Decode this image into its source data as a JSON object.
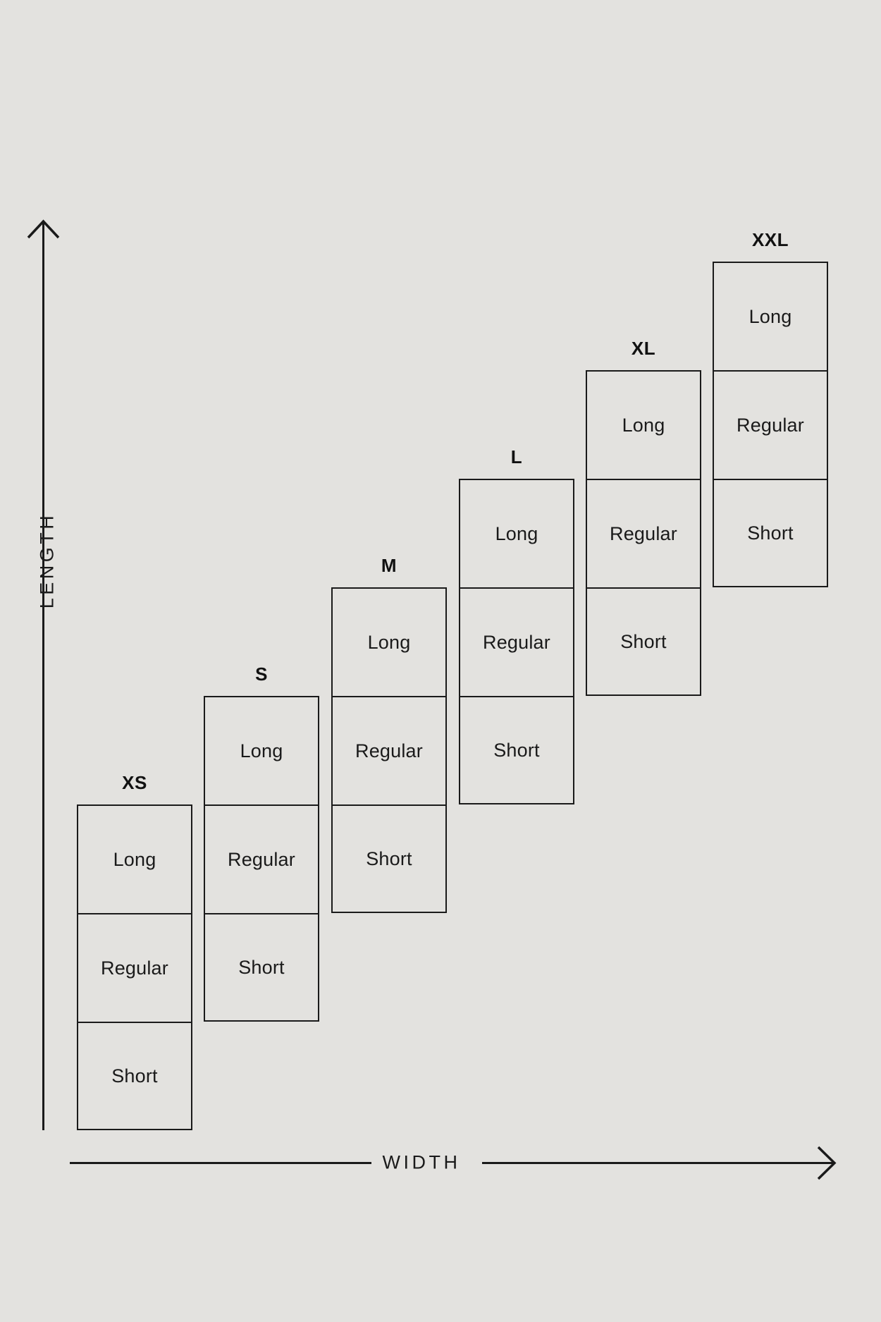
{
  "diagram": {
    "title_visible": false,
    "background_color": "#e3e2df",
    "line_color": "#1a1a1a",
    "axes": {
      "y_label": "LENGTH",
      "x_label": "WIDTH"
    },
    "columns": [
      {
        "size": "XS",
        "cells": [
          "Long",
          "Regular",
          "Short"
        ]
      },
      {
        "size": "S",
        "cells": [
          "Long",
          "Regular",
          "Short"
        ]
      },
      {
        "size": "M",
        "cells": [
          "Long",
          "Regular",
          "Short"
        ]
      },
      {
        "size": "L",
        "cells": [
          "Long",
          "Regular",
          "Short"
        ]
      },
      {
        "size": "XL",
        "cells": [
          "Long",
          "Regular",
          "Short"
        ]
      },
      {
        "size": "XXL",
        "cells": [
          "Long",
          "Regular",
          "Short"
        ]
      }
    ]
  },
  "chart_data": {
    "type": "diagram",
    "title": "",
    "xlabel": "WIDTH",
    "ylabel": "LENGTH",
    "categories": [
      "XS",
      "S",
      "M",
      "L",
      "XL",
      "XXL"
    ],
    "row_labels": [
      "Long",
      "Regular",
      "Short"
    ],
    "note": "Stepped staircase of 6 size columns, each split into 3 length blocks; columns shift right and up with increasing size."
  }
}
